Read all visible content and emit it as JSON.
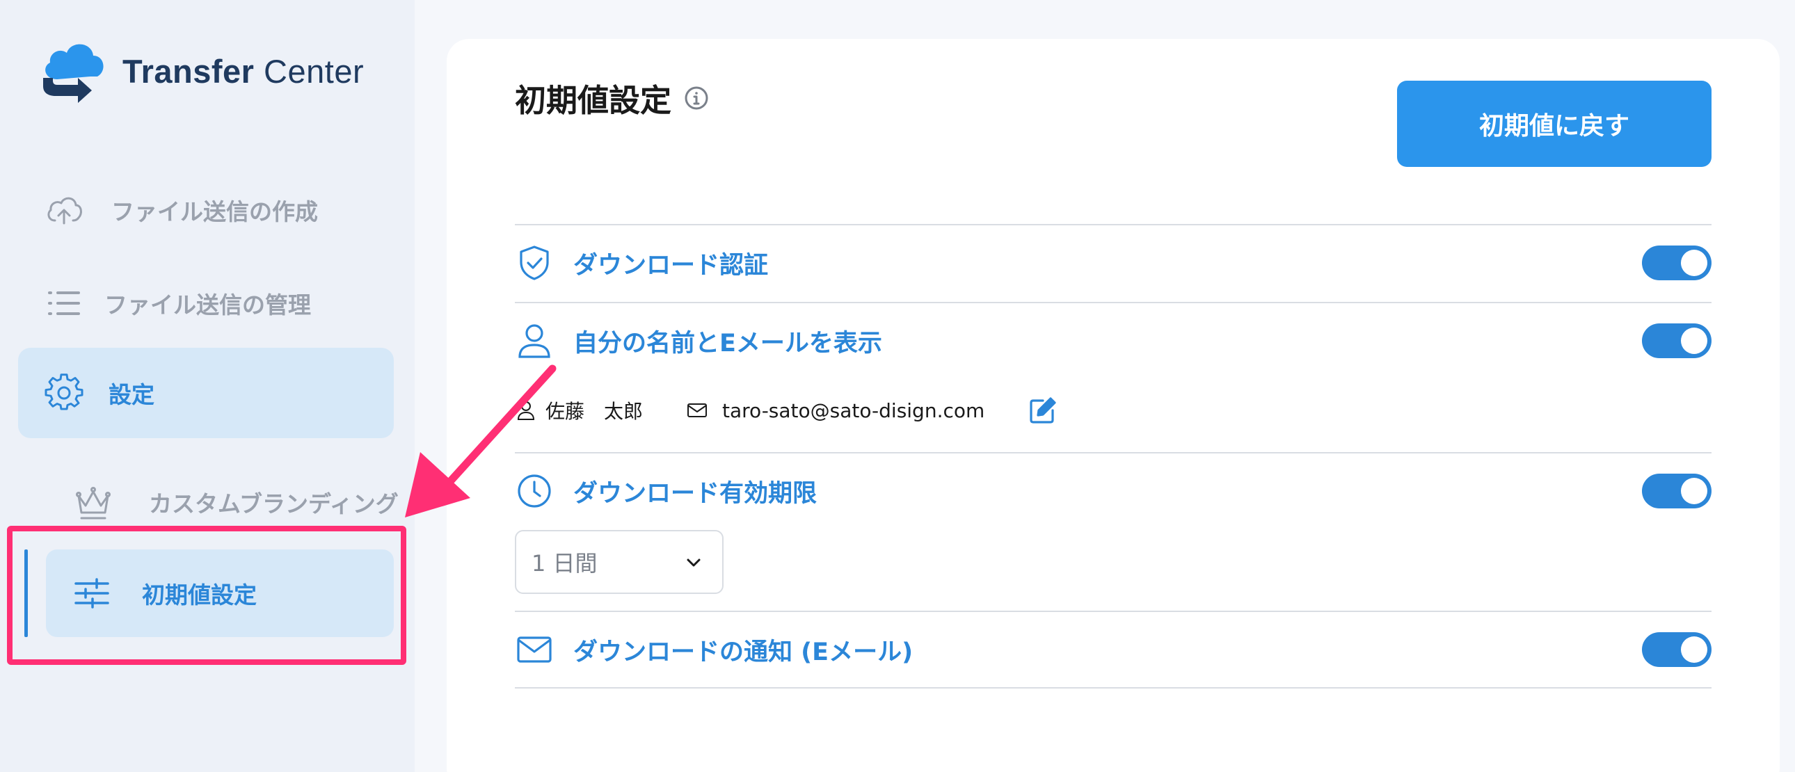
{
  "app": {
    "logo_text_bold": "Transfer",
    "logo_text_light": " Center"
  },
  "sidebar": {
    "items": [
      {
        "label": "ファイル送信の作成",
        "icon": "cloud-upload-icon"
      },
      {
        "label": "ファイル送信の管理",
        "icon": "list-icon"
      },
      {
        "label": "設定",
        "icon": "gear-icon"
      },
      {
        "label": "カスタムブランディング",
        "icon": "crown-icon"
      },
      {
        "label": "初期値設定",
        "icon": "sliders-icon"
      }
    ]
  },
  "main": {
    "title": "初期値設定",
    "reset_button": "初期値に戻す",
    "settings": [
      {
        "label": "ダウンロード認証",
        "icon": "shield-check-icon",
        "enabled": true
      },
      {
        "label": "自分の名前とEメールを表示",
        "icon": "user-icon",
        "enabled": true
      },
      {
        "label": "ダウンロード有効期限",
        "icon": "clock-icon",
        "enabled": true
      },
      {
        "label": "ダウンロードの通知 (Eメール)",
        "icon": "mail-icon",
        "enabled": true
      }
    ],
    "user": {
      "name": "佐藤　太郎",
      "email": "taro-sato@sato-disign.com"
    },
    "expiry_select": {
      "value": "1 日間"
    }
  },
  "colors": {
    "accent": "#2b86d8",
    "button": "#2b95ec",
    "highlight": "#ff2f74",
    "sidebar_bg": "#edf1f8",
    "active_bg": "#d6e8f8"
  }
}
